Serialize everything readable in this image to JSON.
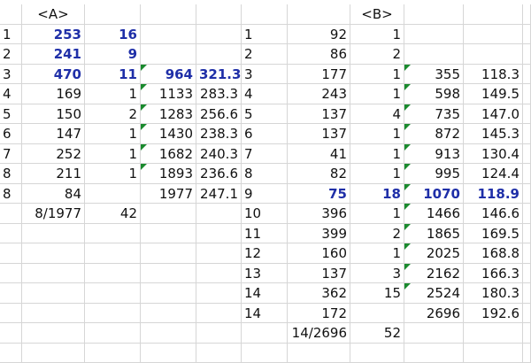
{
  "colors": {
    "highlight_text": "#1f2fa8",
    "gridline": "#d6d6d6",
    "marker_triangle": "#1a8a2e"
  },
  "grid": {
    "rows": [
      {
        "cells": [
          "",
          "<A>",
          "",
          "",
          "",
          "",
          "",
          "<B>",
          "",
          "",
          ""
        ]
      },
      {
        "cells": [
          "1",
          "253",
          "16",
          "",
          "",
          "1",
          "92",
          "1",
          "",
          "",
          ""
        ],
        "bold": [
          1,
          2
        ]
      },
      {
        "cells": [
          "2",
          "241",
          "9",
          "",
          "",
          "2",
          "86",
          "2",
          "",
          "",
          ""
        ],
        "bold": [
          1,
          2
        ]
      },
      {
        "cells": [
          "3",
          "470",
          "11",
          "964",
          "321.3",
          "3",
          "177",
          "1",
          "355",
          "118.3",
          ""
        ],
        "bold": [
          1,
          2,
          3,
          4
        ],
        "marker": [
          3,
          8
        ]
      },
      {
        "cells": [
          "4",
          "169",
          "1",
          "1133",
          "283.3",
          "4",
          "243",
          "1",
          "598",
          "149.5",
          ""
        ],
        "marker": [
          3,
          8
        ]
      },
      {
        "cells": [
          "5",
          "150",
          "2",
          "1283",
          "256.6",
          "5",
          "137",
          "4",
          "735",
          "147.0",
          ""
        ],
        "marker": [
          3,
          8
        ]
      },
      {
        "cells": [
          "6",
          "147",
          "1",
          "1430",
          "238.3",
          "6",
          "137",
          "1",
          "872",
          "145.3",
          ""
        ],
        "marker": [
          3,
          8
        ]
      },
      {
        "cells": [
          "7",
          "252",
          "1",
          "1682",
          "240.3",
          "7",
          "41",
          "1",
          "913",
          "130.4",
          ""
        ],
        "marker": [
          3,
          8
        ]
      },
      {
        "cells": [
          "8",
          "211",
          "1",
          "1893",
          "236.6",
          "8",
          "82",
          "1",
          "995",
          "124.4",
          ""
        ],
        "marker": [
          3,
          8
        ]
      },
      {
        "cells": [
          "8",
          "84",
          "",
          "1977",
          "247.1",
          "9",
          "75",
          "18",
          "1070",
          "118.9",
          ""
        ],
        "bold": [
          6,
          7,
          8,
          9
        ],
        "marker": [
          8
        ]
      },
      {
        "cells": [
          "",
          "8/1977",
          "42",
          "",
          "",
          "10",
          "396",
          "1",
          "1466",
          "146.6",
          ""
        ],
        "marker": [
          8
        ]
      },
      {
        "cells": [
          "",
          "",
          "",
          "",
          "",
          "11",
          "399",
          "2",
          "1865",
          "169.5",
          ""
        ],
        "marker": [
          8
        ]
      },
      {
        "cells": [
          "",
          "",
          "",
          "",
          "",
          "12",
          "160",
          "1",
          "2025",
          "168.8",
          ""
        ],
        "marker": [
          8
        ]
      },
      {
        "cells": [
          "",
          "",
          "",
          "",
          "",
          "13",
          "137",
          "3",
          "2162",
          "166.3",
          ""
        ],
        "marker": [
          8
        ]
      },
      {
        "cells": [
          "",
          "",
          "",
          "",
          "",
          "14",
          "362",
          "15",
          "2524",
          "180.3",
          ""
        ],
        "marker": [
          8
        ]
      },
      {
        "cells": [
          "",
          "",
          "",
          "",
          "",
          "14",
          "172",
          "",
          "2696",
          "192.6",
          ""
        ]
      },
      {
        "cells": [
          "",
          "",
          "",
          "",
          "",
          "",
          "14/2696",
          "52",
          "",
          "",
          ""
        ]
      },
      {
        "cells": [
          "",
          "",
          "",
          "",
          "",
          "",
          "",
          "",
          "",
          "",
          ""
        ]
      }
    ]
  }
}
